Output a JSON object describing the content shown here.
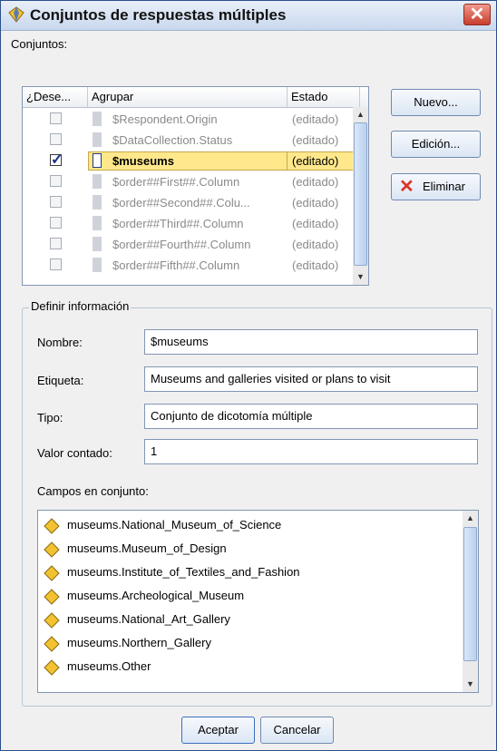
{
  "window": {
    "title": "Conjuntos de respuestas múltiples",
    "close_symbol": "✕"
  },
  "sets_label": "Conjuntos:",
  "table": {
    "columns": [
      "¿Dese...",
      "Agrupar",
      "Estado"
    ],
    "rows": [
      {
        "name": "$Respondent.Origin",
        "estado": "(editado)",
        "checked": false,
        "selected": false
      },
      {
        "name": "$DataCollection.Status",
        "estado": "(editado)",
        "checked": false,
        "selected": false
      },
      {
        "name": "$museums",
        "estado": "(editado)",
        "checked": true,
        "selected": true
      },
      {
        "name": "$order##First##.Column",
        "estado": "(editado)",
        "checked": false,
        "selected": false
      },
      {
        "name": "$order##Second##.Colu...",
        "estado": "(editado)",
        "checked": false,
        "selected": false
      },
      {
        "name": "$order##Third##.Column",
        "estado": "(editado)",
        "checked": false,
        "selected": false
      },
      {
        "name": "$order##Fourth##.Column",
        "estado": "(editado)",
        "checked": false,
        "selected": false
      },
      {
        "name": "$order##Fifth##.Column",
        "estado": "(editado)",
        "checked": false,
        "selected": false
      }
    ]
  },
  "side_buttons": {
    "new": "Nuevo...",
    "edit": "Edición...",
    "delete": "Eliminar"
  },
  "definition": {
    "group_title": "Definir información",
    "name_label": "Nombre:",
    "name_value": "$museums",
    "label_label": "Etiqueta:",
    "label_value": "Museums and galleries visited or plans to visit",
    "type_label": "Tipo:",
    "type_value": "Conjunto de dicotomía múltiple",
    "count_label": "Valor contado:",
    "count_value": "1",
    "fields_label": "Campos en conjunto:",
    "fields": [
      "museums.National_Museum_of_Science",
      "museums.Museum_of_Design",
      "museums.Institute_of_Textiles_and_Fashion",
      "museums.Archeological_Museum",
      "museums.National_Art_Gallery",
      "museums.Northern_Gallery",
      "museums.Other"
    ]
  },
  "footer": {
    "ok": "Aceptar",
    "cancel": "Cancelar"
  },
  "colors": {
    "selection": "#ffe88c",
    "field_icon": "#f2c230",
    "delete_x": "#d9352a"
  }
}
